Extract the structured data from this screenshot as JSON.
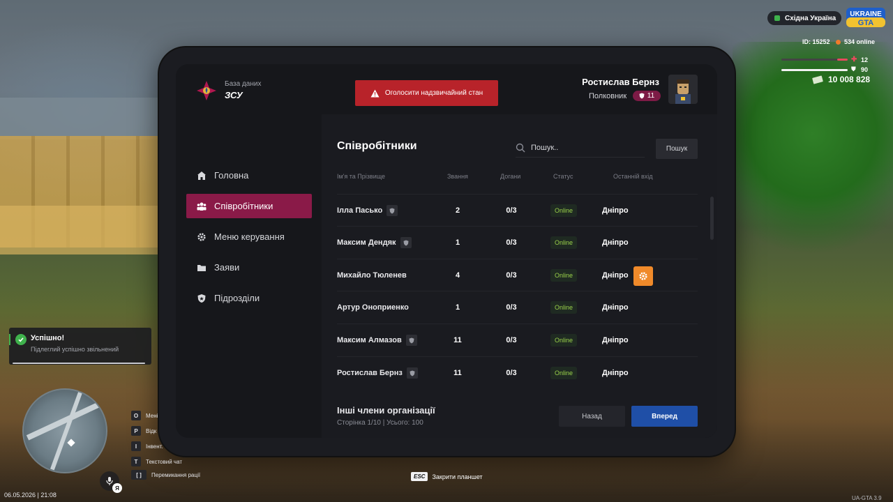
{
  "app": {
    "brand_subtitle": "База даних",
    "brand_title": "ЗСУ",
    "emergency_button": "Оголосити надзвичайний стан"
  },
  "user": {
    "name": "Ростислав Бернз",
    "rank": "Полковник",
    "rank_level": "11"
  },
  "sidebar": {
    "items": [
      {
        "label": "Головна",
        "icon": "home-icon",
        "active": false
      },
      {
        "label": "Співробітники",
        "icon": "users-icon",
        "active": true
      },
      {
        "label": "Меню керування",
        "icon": "gear-icon",
        "active": false
      },
      {
        "label": "Заяви",
        "icon": "folder-icon",
        "active": false
      },
      {
        "label": "Підрозділи",
        "icon": "shield-icon",
        "active": false
      }
    ]
  },
  "main": {
    "title": "Співробітники",
    "search": {
      "placeholder": "Пошук..",
      "button": "Пошук"
    },
    "table": {
      "headers": [
        "Ім'я та Прізвище",
        "Звання",
        "Догани",
        "Статус",
        "Останній вхід"
      ],
      "rows": [
        {
          "name": "Ілла Пасько",
          "rank": "2",
          "reprimands": "0/3",
          "status": "Online",
          "last_login": "Дніпро"
        },
        {
          "name": "Максим Дендяк",
          "rank": "1",
          "reprimands": "0/3",
          "status": "Online",
          "last_login": "Дніпро"
        },
        {
          "name": "Михайло Тюленев",
          "rank": "4",
          "reprimands": "0/3",
          "status": "Online",
          "last_login": "Дніпро"
        },
        {
          "name": "Артур Оноприенко",
          "rank": "1",
          "reprimands": "0/3",
          "status": "Online",
          "last_login": "Дніпро"
        },
        {
          "name": "Максим Алмазов",
          "rank": "11",
          "reprimands": "0/3",
          "status": "Online",
          "last_login": "Дніпро"
        },
        {
          "name": "Ростислав Бернз",
          "rank": "11",
          "reprimands": "0/3",
          "status": "Online",
          "last_login": "Дніпро"
        }
      ]
    },
    "footer": {
      "title": "Інші члени організації",
      "page_info": "Сторінка 1/10 | Усього: 100",
      "back": "Назад",
      "next": "Вперед"
    }
  },
  "hud": {
    "region": "Східна Україна",
    "logo_text": "UKRAINE GTA",
    "id": "ID: 15252",
    "online": "534 online",
    "health": "12",
    "armor": "90",
    "money": "10 008 828",
    "datetime": "06.05.2026 | 21:08",
    "version": "UA-GTA 3.9",
    "esc_key": "ESC",
    "esc_label": "Закрити планшет",
    "voice_badge": "Я",
    "keys": [
      {
        "key": "O",
        "label": "Мені"
      },
      {
        "key": "P",
        "label": "Відк"
      },
      {
        "key": "I",
        "label": "Інвент."
      },
      {
        "key": "T",
        "label": "Текстовий чат"
      },
      {
        "key": "[ ]",
        "label": "Перемикання рації"
      }
    ]
  },
  "toast": {
    "title": "Успішно!",
    "message": "Підлеглий успішно звільнений"
  },
  "colors": {
    "accent": "#8a1a48",
    "danger": "#b8232a",
    "primary": "#1f4fa7",
    "online": "#9ad14a",
    "gear": "#f08a2a"
  }
}
